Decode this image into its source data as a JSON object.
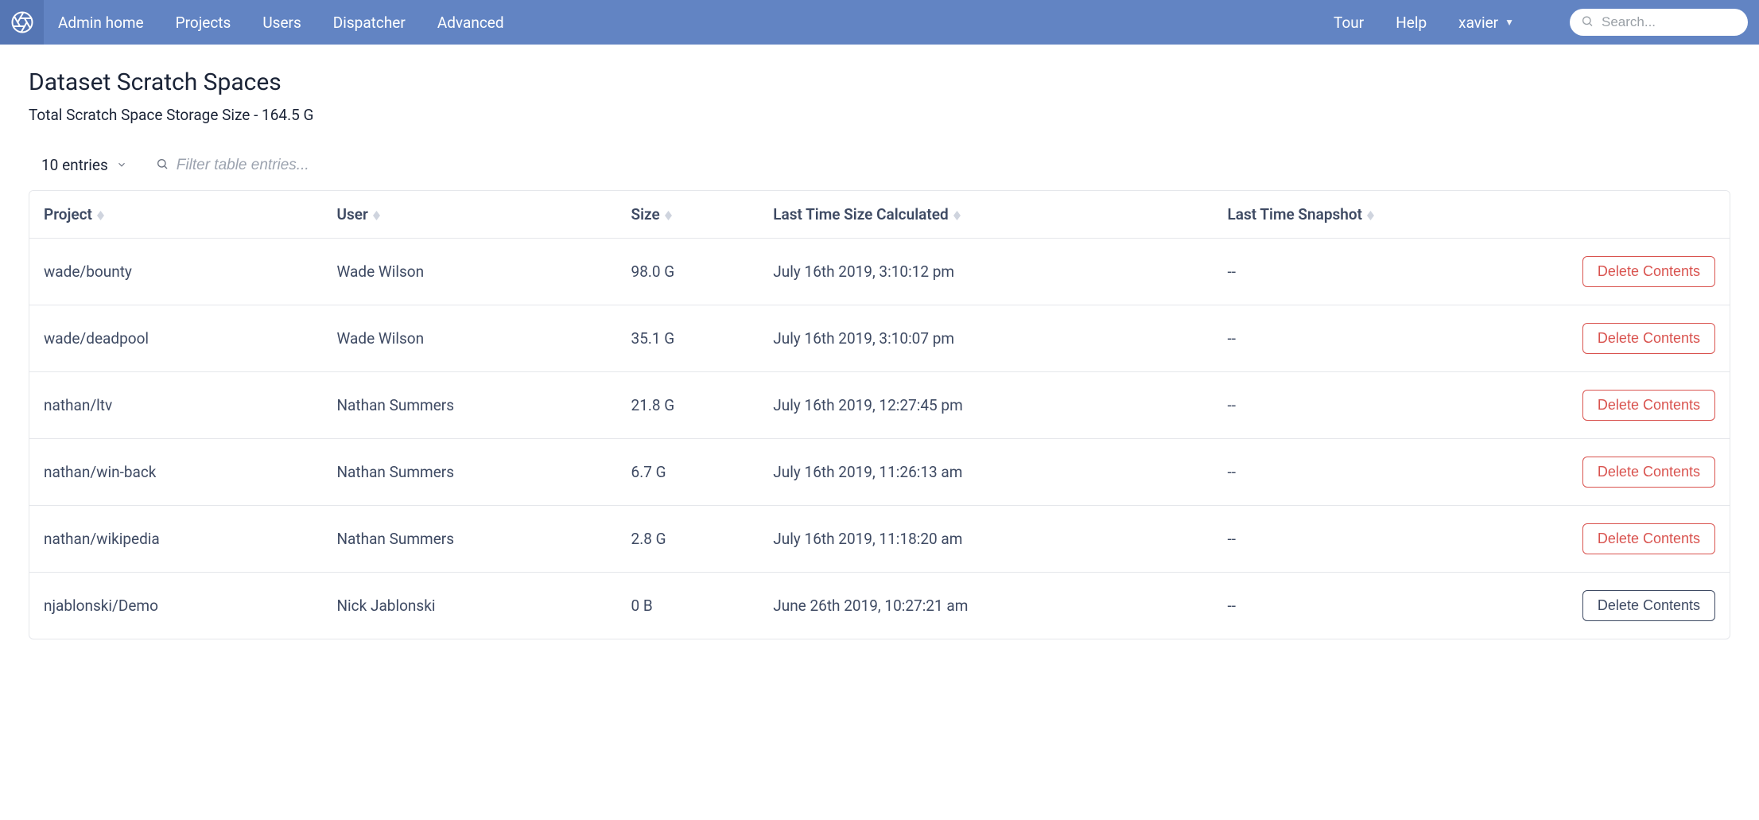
{
  "nav": {
    "left": [
      "Admin home",
      "Projects",
      "Users",
      "Dispatcher",
      "Advanced"
    ],
    "right": [
      "Tour",
      "Help"
    ],
    "user": "xavier",
    "search_placeholder": "Search..."
  },
  "page": {
    "title": "Dataset Scratch Spaces",
    "subtitle": "Total Scratch Space Storage Size - 164.5 G"
  },
  "controls": {
    "entries_label": "10 entries",
    "filter_placeholder": "Filter table entries..."
  },
  "table": {
    "columns": [
      "Project",
      "User",
      "Size",
      "Last Time Size Calculated",
      "Last Time Snapshot"
    ],
    "action_label": "Delete Contents",
    "rows": [
      {
        "project": "wade/bounty",
        "user": "Wade Wilson",
        "size": "98.0 G",
        "last_calc": "July 16th 2019, 3:10:12 pm",
        "last_snap": "--",
        "danger": true
      },
      {
        "project": "wade/deadpool",
        "user": "Wade Wilson",
        "size": "35.1 G",
        "last_calc": "July 16th 2019, 3:10:07 pm",
        "last_snap": "--",
        "danger": true
      },
      {
        "project": "nathan/ltv",
        "user": "Nathan Summers",
        "size": "21.8 G",
        "last_calc": "July 16th 2019, 12:27:45 pm",
        "last_snap": "--",
        "danger": true
      },
      {
        "project": "nathan/win-back",
        "user": "Nathan Summers",
        "size": "6.7 G",
        "last_calc": "July 16th 2019, 11:26:13 am",
        "last_snap": "--",
        "danger": true
      },
      {
        "project": "nathan/wikipedia",
        "user": "Nathan Summers",
        "size": "2.8 G",
        "last_calc": "July 16th 2019, 11:18:20 am",
        "last_snap": "--",
        "danger": true
      },
      {
        "project": "njablonski/Demo",
        "user": "Nick Jablonski",
        "size": "0 B",
        "last_calc": "June 26th 2019, 10:27:21 am",
        "last_snap": "--",
        "danger": false
      }
    ]
  }
}
